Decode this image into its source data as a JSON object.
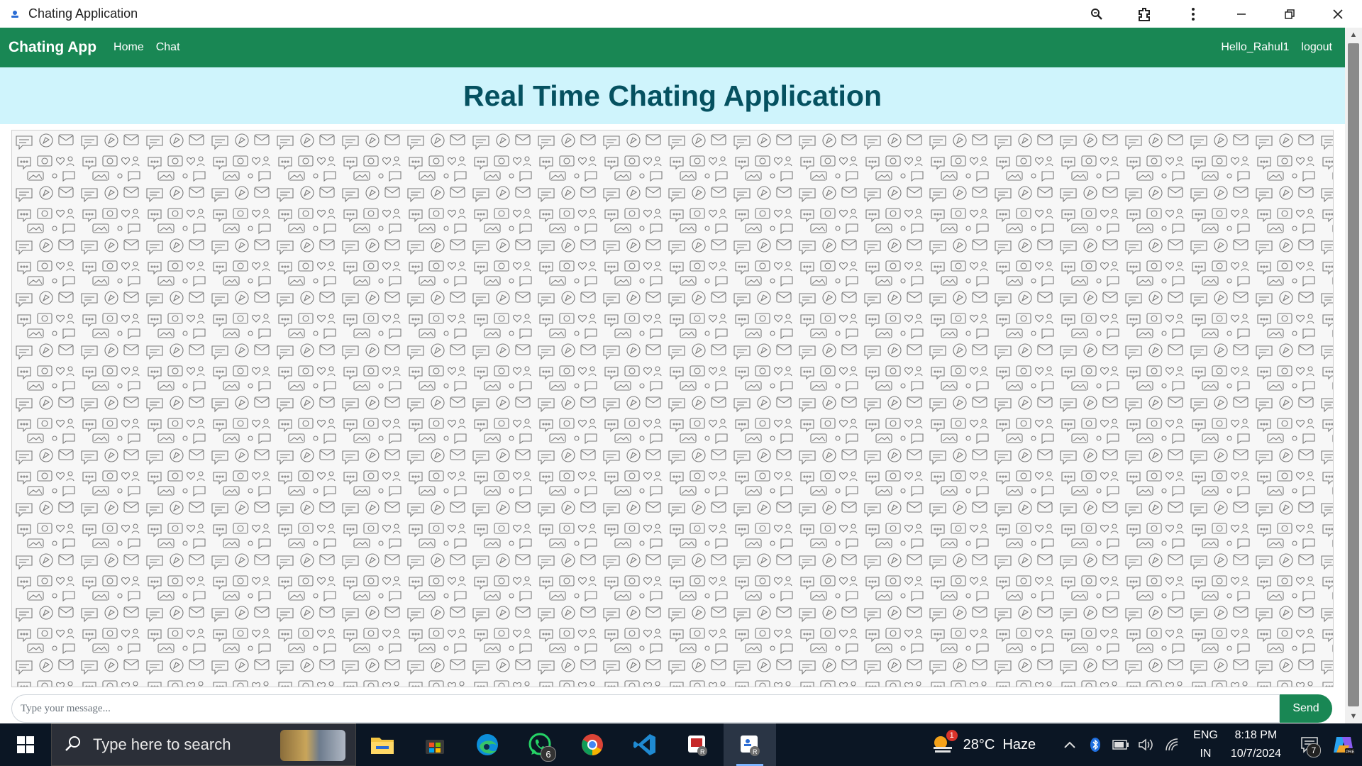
{
  "window": {
    "title": "Chating Application",
    "icon": "app-logo-icon",
    "controls": [
      "zoom-icon",
      "extensions-icon",
      "more-icon",
      "minimize-icon",
      "restore-icon",
      "close-icon"
    ]
  },
  "navbar": {
    "brand": "Chating App",
    "links": [
      "Home",
      "Chat"
    ],
    "user": "Hello_Rahul1",
    "logout": "logout",
    "color": "#198754"
  },
  "banner": {
    "heading": "Real Time Chating Application",
    "bg_color": "#cff4fc",
    "text_color": "#055160"
  },
  "chat": {
    "background": "doodle-pattern",
    "messages": []
  },
  "composer": {
    "placeholder": "Type your message...",
    "value": "",
    "send_label": "Send"
  },
  "taskbar": {
    "search_placeholder": "Type here to search",
    "apps": [
      {
        "name": "file-explorer-icon"
      },
      {
        "name": "microsoft-store-icon"
      },
      {
        "name": "edge-icon"
      },
      {
        "name": "whatsapp-icon",
        "badge": "6"
      },
      {
        "name": "chrome-icon"
      },
      {
        "name": "vscode-icon"
      },
      {
        "name": "app-icon-r"
      },
      {
        "name": "chating-app-icon",
        "active": true
      }
    ],
    "weather": {
      "badge": "1",
      "temp": "28°C",
      "condition": "Haze"
    },
    "language": {
      "line1": "ENG",
      "line2": "IN"
    },
    "clock": {
      "time": "8:18 PM",
      "date": "10/7/2024"
    },
    "notifications_badge": "7"
  }
}
